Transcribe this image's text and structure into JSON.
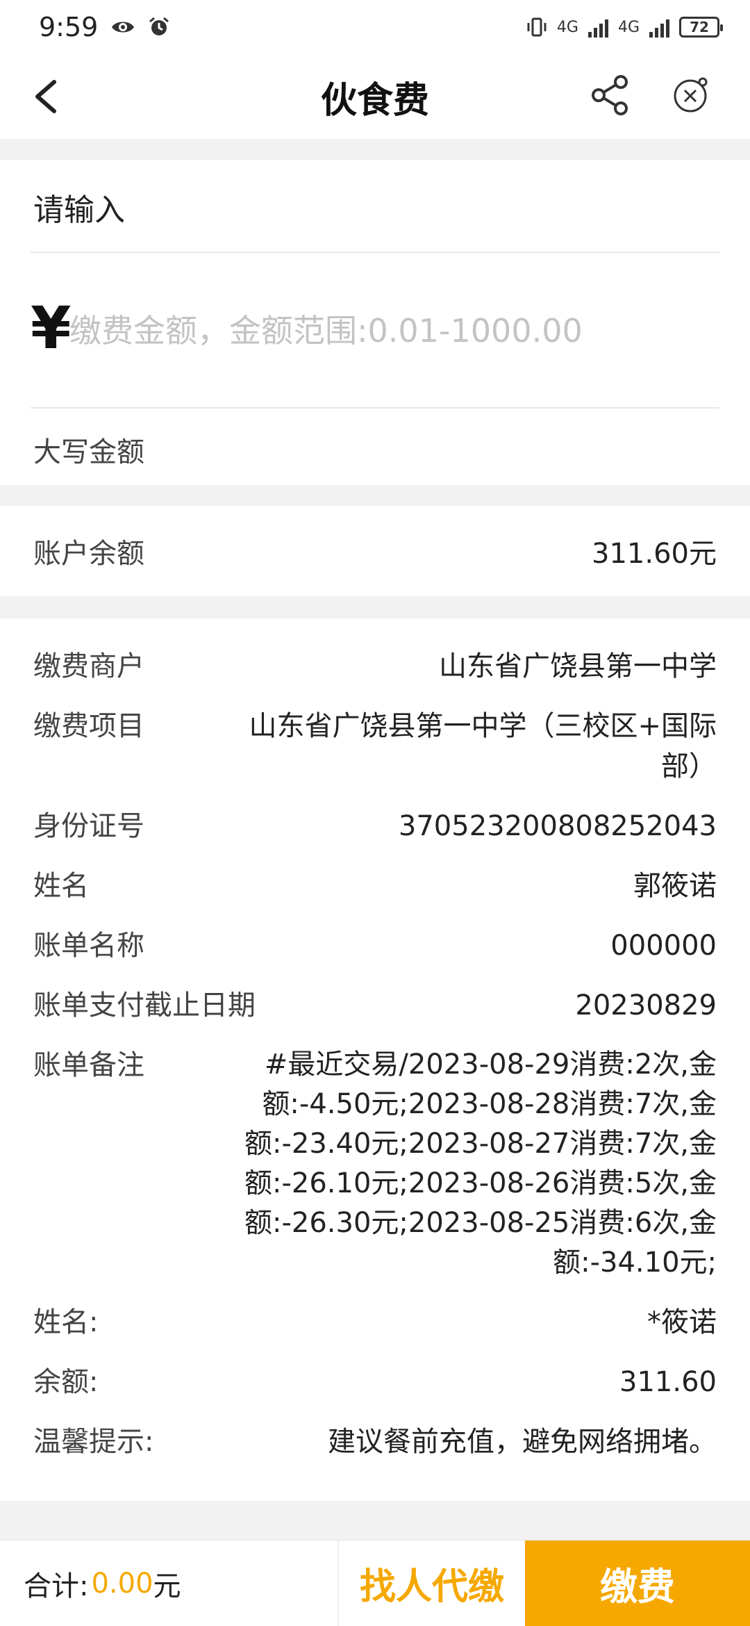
{
  "status": {
    "time": "9:59",
    "net1": "4G",
    "net2": "4G",
    "battery": "72"
  },
  "header": {
    "title": "伙食费"
  },
  "payment": {
    "input_label": "请输入",
    "currency_symbol": "¥",
    "amount_placeholder": "缴费金额，金额范围:0.01-1000.00",
    "uppercase_label": "大写金额"
  },
  "balance": {
    "label": "账户余额",
    "value": "311.60元"
  },
  "details": [
    {
      "label": "缴费商户",
      "value": "山东省广饶县第一中学"
    },
    {
      "label": "缴费项目",
      "value": "山东省广饶县第一中学（三校区+国际部）"
    },
    {
      "label": "身份证号",
      "value": "370523200808252043"
    },
    {
      "label": "姓名",
      "value": "郭筱诺"
    },
    {
      "label": "账单名称",
      "value": "000000"
    },
    {
      "label": "账单支付截止日期",
      "value": "20230829"
    },
    {
      "label": "账单备注",
      "value": "#最近交易/2023-08-29消费:2次,金额:-4.50元;2023-08-28消费:7次,金额:-23.40元;2023-08-27消费:7次,金额:-26.10元;2023-08-26消费:5次,金额:-26.30元;2023-08-25消费:6次,金额:-34.10元;"
    },
    {
      "label": "姓名:",
      "value": "*筱诺"
    },
    {
      "label": "余额:",
      "value": "311.60"
    },
    {
      "label": "温馨提示:",
      "value": "建议餐前充值，避免网络拥堵。"
    }
  ],
  "footer": {
    "total_label": "合计:",
    "total_amount": "0.00",
    "total_unit": "元",
    "proxy_button": "找人代缴",
    "pay_button": "缴费"
  },
  "colors": {
    "accent": "#f5a800",
    "background": "#f2f2f2"
  }
}
